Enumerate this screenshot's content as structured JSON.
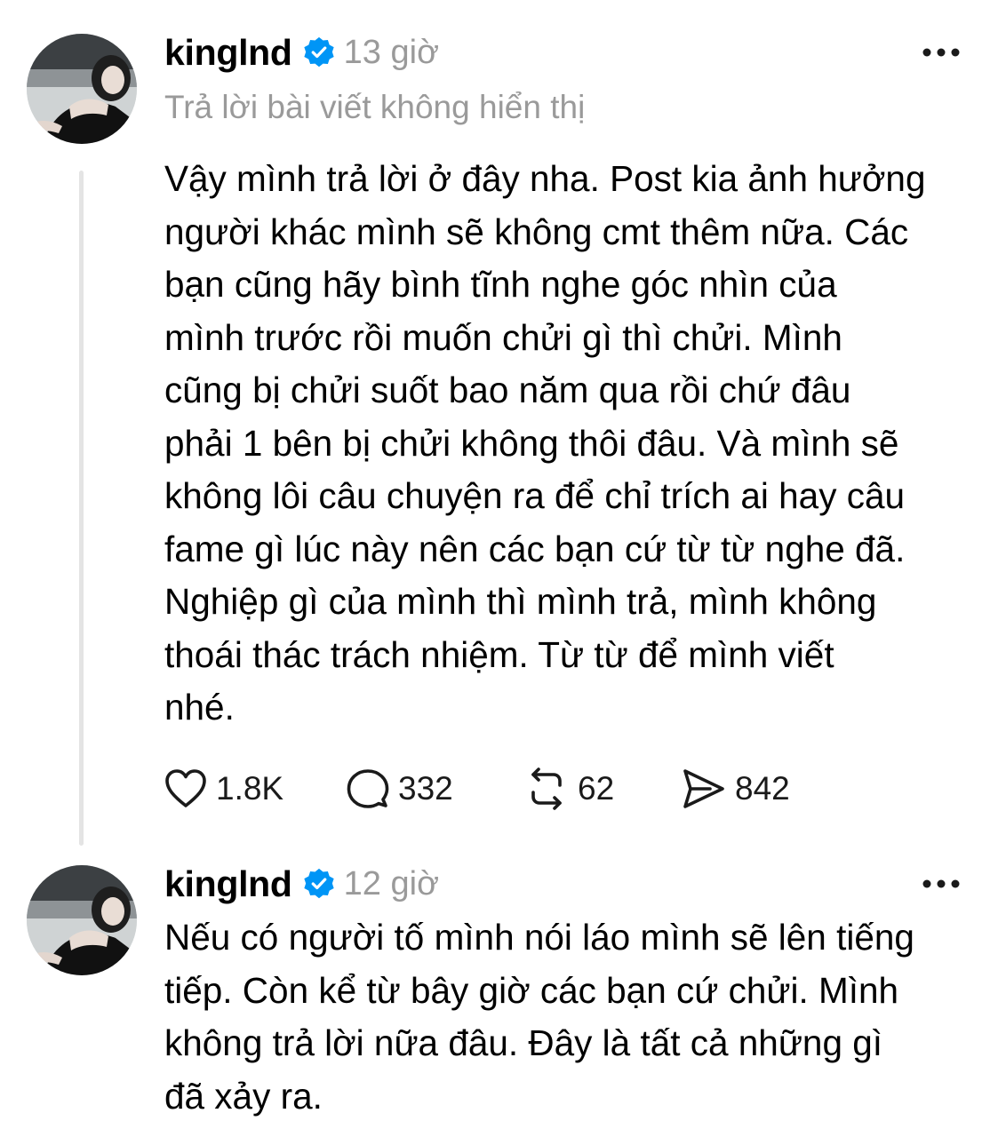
{
  "posts": [
    {
      "username": "kinglnd",
      "timestamp": "13 giờ",
      "context": "Trả lời bài viết không hiển thị",
      "body_lines": [
        "Vậy mình trả lời ở đây nha. Post kia ảnh hưởng",
        "người khác mình sẽ không cmt thêm nữa. Các",
        "bạn cũng hãy bình tĩnh nghe góc nhìn của",
        "mình trước rồi muốn chửi gì thì chửi. Mình",
        "cũng bị chửi suốt bao năm qua rồi chứ đâu",
        "phải 1 bên bị chửi không thôi đâu. Và mình sẽ",
        "không lôi câu chuyện ra để chỉ trích ai hay câu",
        "fame gì lúc này nên các bạn cứ từ từ nghe đã.",
        "Nghiệp gì của mình thì mình trả, mình không",
        "thoái thác trách nhiệm. Từ từ để mình viết",
        "nhé."
      ],
      "stats": {
        "likes": "1.8K",
        "comments": "332",
        "reposts": "62",
        "shares": "842"
      }
    },
    {
      "username": "kinglnd",
      "timestamp": "12 giờ",
      "body_lines": [
        "Nếu có người tố mình nói láo mình sẽ lên tiếng",
        "tiếp. Còn kể từ bây giờ các bạn cứ chửi. Mình",
        "không trả lời nữa đâu. Đây là tất cả những gì",
        "đã xảy ra."
      ]
    }
  ],
  "icons": {
    "verified": "verified-badge-icon",
    "more": "more-horizontal-icon",
    "like": "heart-icon",
    "comment": "comment-bubble-icon",
    "repost": "repost-arrows-icon",
    "share": "send-icon"
  },
  "colors": {
    "verified": "#0095f6",
    "muted_text": "#9a9a9a",
    "thread_line": "#e4e4e4"
  }
}
